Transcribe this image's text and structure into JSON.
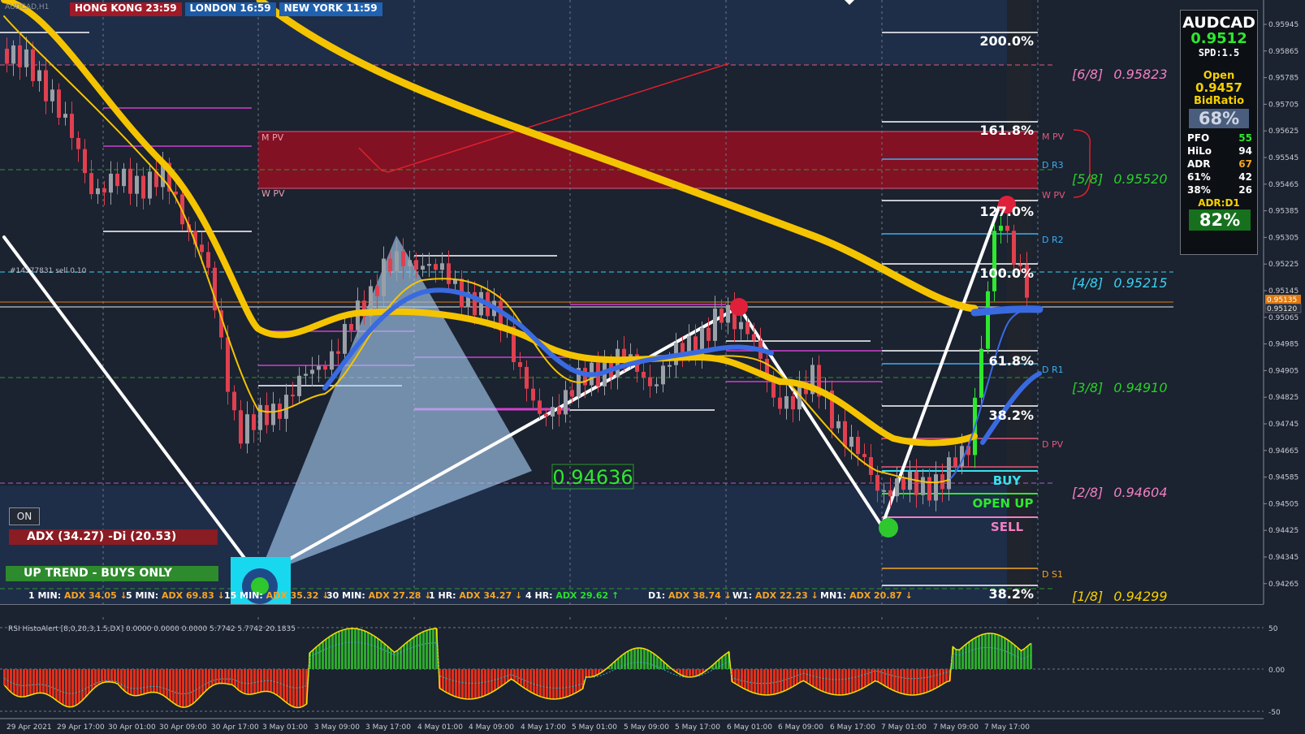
{
  "symbol": "AUDCAD",
  "window_title": "AUDCAD,H1",
  "sessions": [
    {
      "name": "HONG KONG",
      "time": "23:59",
      "label": "HONG KONG 23:59"
    },
    {
      "name": "LONDON",
      "time": "16:59",
      "label": "LONDON 16:59"
    },
    {
      "name": "NEW YORK",
      "time": "11:59",
      "label": "NEW YORK 11:59"
    }
  ],
  "info_panel": {
    "symbol": "AUDCAD",
    "price": "0.9512",
    "spread": "SPD:1.5",
    "open_label": "Open",
    "open_value": "0.9457",
    "bid_ratio_label": "BidRatio",
    "bid_ratio_value": "68%",
    "stats": [
      {
        "label": "PFO",
        "value": "55",
        "color": "#2ee82e"
      },
      {
        "label": "HiLo",
        "value": "94",
        "color": "#ffffff"
      },
      {
        "label": "ADR",
        "value": "67",
        "color": "#f5a623"
      },
      {
        "label": "61%",
        "value": "42",
        "color": "#ffffff"
      },
      {
        "label": "38%",
        "value": "26",
        "color": "#ffffff"
      }
    ],
    "adr_label": "ADR:D1",
    "adr_value": "82%"
  },
  "price_axis": [
    "0.95945",
    "0.95865",
    "0.95785",
    "0.95705",
    "0.95625",
    "0.95545",
    "0.95465",
    "0.95385",
    "0.95305",
    "0.95225",
    "0.95145",
    "0.95065",
    "0.94985",
    "0.94905",
    "0.94825",
    "0.94745",
    "0.94665",
    "0.94585",
    "0.94505",
    "0.94425",
    "0.94345",
    "0.94265"
  ],
  "price_axis_tags": [
    {
      "label": "0.95135",
      "bg": "#e07a10"
    },
    {
      "label": "0.95120",
      "bg": "#2a2f3a"
    }
  ],
  "fib_levels": [
    {
      "label": "200.0%",
      "color": "#ffffff"
    },
    {
      "label": "161.8%",
      "color": "#ffffff"
    },
    {
      "label": "127.0%",
      "color": "#ffffff"
    },
    {
      "label": "100.0%",
      "color": "#ffffff"
    },
    {
      "label": "61.8%",
      "color": "#ffffff"
    },
    {
      "label": "38.2%",
      "color": "#ffffff"
    },
    {
      "label": "38.2%",
      "color": "#ffffff"
    }
  ],
  "murrey_levels": [
    {
      "label": "[6/8]",
      "price": "0.95823",
      "color": "#f080c0"
    },
    {
      "label": "[5/8]",
      "price": "0.95520",
      "color": "#28d028"
    },
    {
      "label": "[4/8]",
      "price": "0.95215",
      "color": "#3ad0f0"
    },
    {
      "label": "[3/8]",
      "price": "0.94910",
      "color": "#28d028"
    },
    {
      "label": "[2/8]",
      "price": "0.94604",
      "color": "#f080c0"
    },
    {
      "label": "[1/8]",
      "price": "0.94299",
      "color": "#f5d000"
    }
  ],
  "pivot_labels": [
    {
      "label": "M PV",
      "color": "#e35a7a"
    },
    {
      "label": "D R3",
      "color": "#3ab0f0"
    },
    {
      "label": "W PV",
      "color": "#e35a7a"
    },
    {
      "label": "D R2",
      "color": "#3ab0f0"
    },
    {
      "label": "D R1",
      "color": "#3ab0f0"
    },
    {
      "label": "D PV",
      "color": "#e35a7a"
    },
    {
      "label": "D S1",
      "color": "#f5a623"
    }
  ],
  "zone_labels": {
    "m_pv": "M PV",
    "w_pv": "W PV"
  },
  "order_label": "#14177831 sell 0.10",
  "signals": {
    "buy": "BUY",
    "open_up": "OPEN UP",
    "sell": "SELL"
  },
  "price_callout": "0.94636",
  "on_button": "ON",
  "adx_status": "ADX (34.27) -Di (20.53)",
  "trend_status": "UP TREND - BUYS ONLY",
  "adx_strip": [
    {
      "tf": "1 MIN:",
      "adx": "ADX 34.05",
      "dir": "down"
    },
    {
      "tf": "5 MIN:",
      "adx": "ADX 69.83",
      "dir": "down"
    },
    {
      "tf": "15 MIN:",
      "adx": "ADX 35.32",
      "dir": "down"
    },
    {
      "tf": "30 MIN:",
      "adx": "ADX 27.28",
      "dir": "down"
    },
    {
      "tf": "1 HR:",
      "adx": "ADX 34.27",
      "dir": "down"
    },
    {
      "tf": "4 HR:",
      "adx": "ADX 29.62",
      "dir": "up"
    },
    {
      "tf": "D1:",
      "adx": "ADX 38.74",
      "dir": "down"
    },
    {
      "tf": "W1:",
      "adx": "ADX 22.23",
      "dir": "down"
    },
    {
      "tf": "MN1:",
      "adx": "ADX 20.87",
      "dir": "down"
    }
  ],
  "subwindow": {
    "title": "RSI HistoAlert [8,0,20,3,1.5,DX] 0.0000 0.0000 0.0000 5.7742 5.7742 20.1835",
    "axis": [
      "50",
      "0.00",
      "-50"
    ]
  },
  "time_axis": [
    "29 Apr 2021",
    "29 Apr 17:00",
    "30 Apr 01:00",
    "30 Apr 09:00",
    "30 Apr 17:00",
    "3 May 01:00",
    "3 May 09:00",
    "3 May 17:00",
    "4 May 01:00",
    "4 May 09:00",
    "4 May 17:00",
    "5 May 01:00",
    "5 May 09:00",
    "5 May 17:00",
    "6 May 01:00",
    "6 May 09:00",
    "6 May 17:00",
    "7 May 01:00",
    "7 May 09:00",
    "7 May 17:00"
  ],
  "colors": {
    "background": "#1b2230",
    "bull_candle": "#9aa0a8",
    "bear_candle": "#e0404f",
    "ma_slow": "#f5c400",
    "ma_fast": "#3a6ae0",
    "hist_pos": "#2ea82e",
    "hist_neg": "#e0301a"
  }
}
